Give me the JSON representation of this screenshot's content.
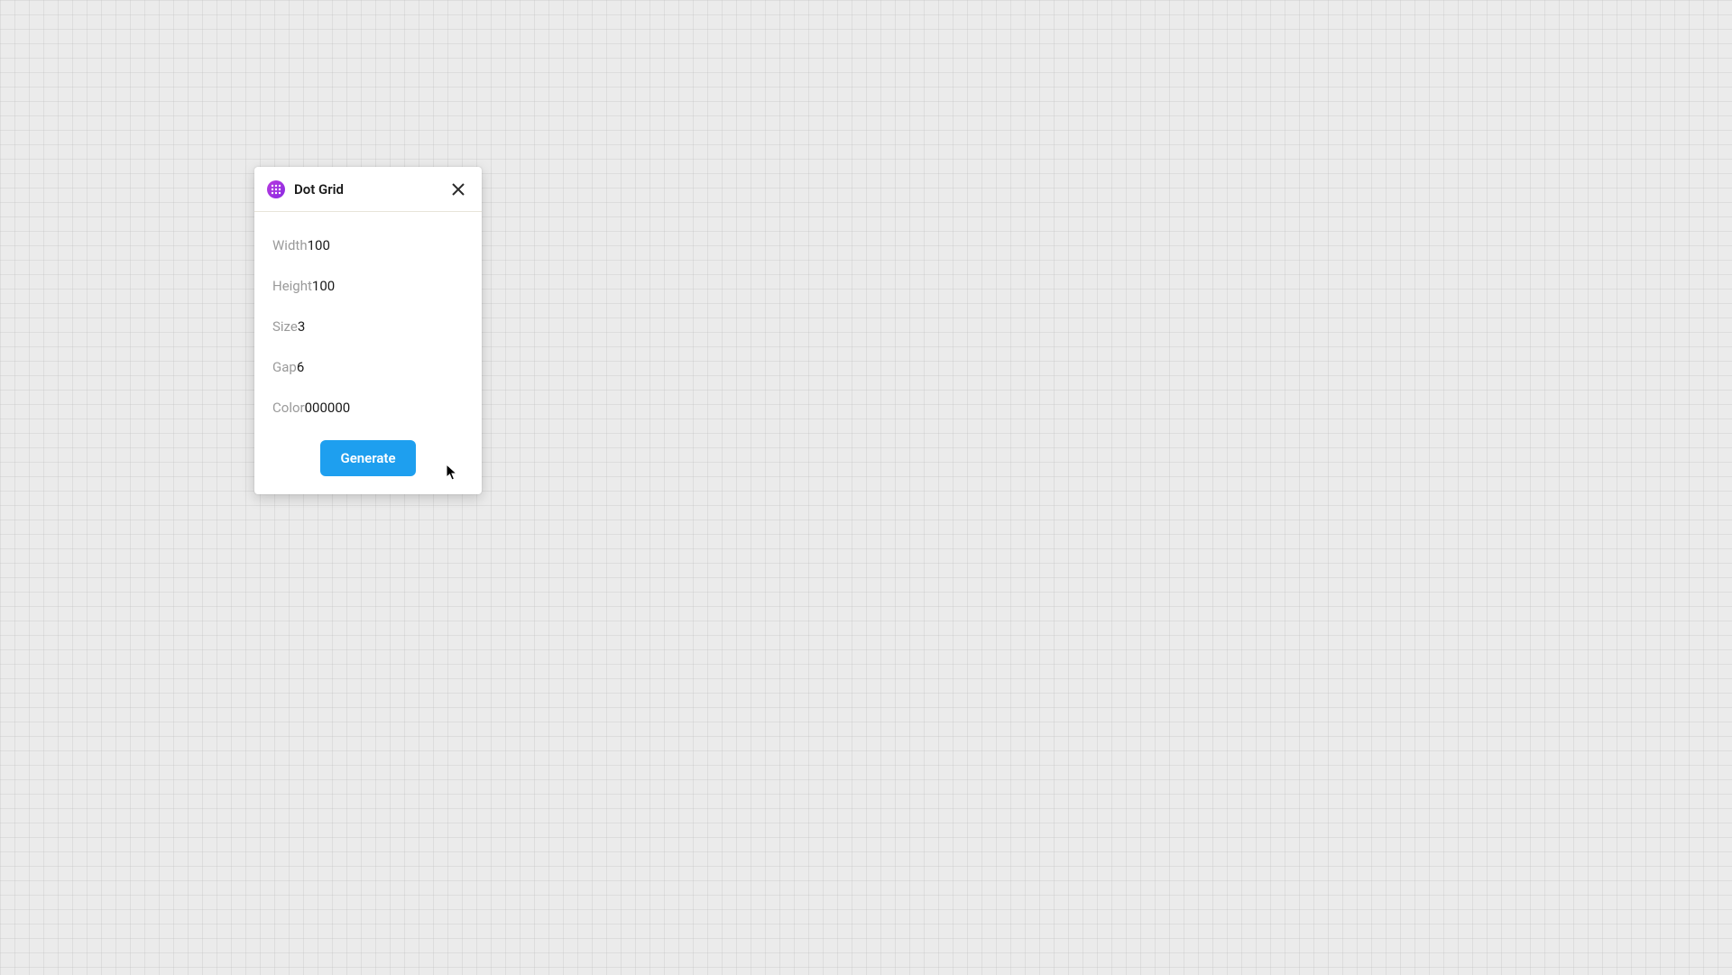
{
  "panel": {
    "title": "Dot Grid",
    "fields": {
      "width": {
        "label": "Width",
        "value": "100"
      },
      "height": {
        "label": "Height",
        "value": "100"
      },
      "size": {
        "label": "Size",
        "value": "3"
      },
      "gap": {
        "label": "Gap",
        "value": "6"
      },
      "color": {
        "label": "Color",
        "value": "000000"
      }
    },
    "generate_label": "Generate"
  }
}
